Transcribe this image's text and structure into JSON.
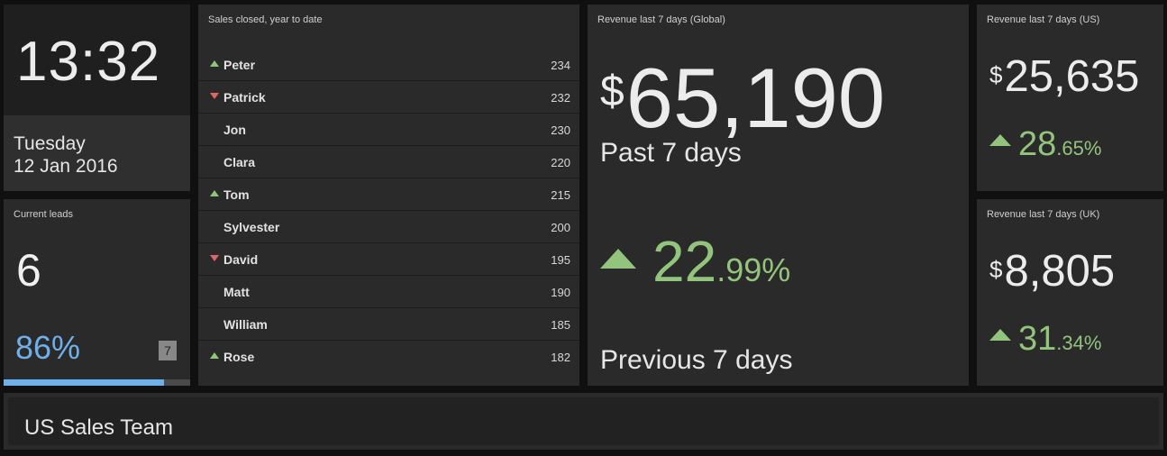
{
  "clock": {
    "time": "13:32",
    "day": "Tuesday",
    "date": "12 Jan 2016"
  },
  "leads": {
    "title": "Current leads",
    "value": "6",
    "percent": "86%",
    "target": "7",
    "progress": 0.86,
    "accent": "#6fb0ea"
  },
  "sales": {
    "title": "Sales closed, year to date",
    "rows": [
      {
        "name": "Peter",
        "value": "234",
        "trend": "up"
      },
      {
        "name": "Patrick",
        "value": "232",
        "trend": "down"
      },
      {
        "name": "Jon",
        "value": "230",
        "trend": "none"
      },
      {
        "name": "Clara",
        "value": "220",
        "trend": "none"
      },
      {
        "name": "Tom",
        "value": "215",
        "trend": "up"
      },
      {
        "name": "Sylvester",
        "value": "200",
        "trend": "none"
      },
      {
        "name": "David",
        "value": "195",
        "trend": "down"
      },
      {
        "name": "Matt",
        "value": "190",
        "trend": "none"
      },
      {
        "name": "William",
        "value": "185",
        "trend": "none"
      },
      {
        "name": "Rose",
        "value": "182",
        "trend": "up"
      }
    ]
  },
  "global": {
    "title": "Revenue last 7 days (Global)",
    "currency": "$",
    "value": "65,190",
    "past_label": "Past 7 days",
    "change_int": "22",
    "change_dec": ".99%",
    "prev_label": "Previous 7 days"
  },
  "us": {
    "title": "Revenue last 7 days (US)",
    "currency": "$",
    "value": "25,635",
    "change_int": "28",
    "change_dec": ".65%"
  },
  "uk": {
    "title": "Revenue last 7 days (UK)",
    "currency": "$",
    "value": "8,805",
    "change_int": "31",
    "change_dec": ".34%"
  },
  "footer": {
    "title": "US Sales Team"
  },
  "colors": {
    "positive": "#93c47d",
    "negative": "#e06666",
    "tile_bg": "#2a2a2a"
  }
}
